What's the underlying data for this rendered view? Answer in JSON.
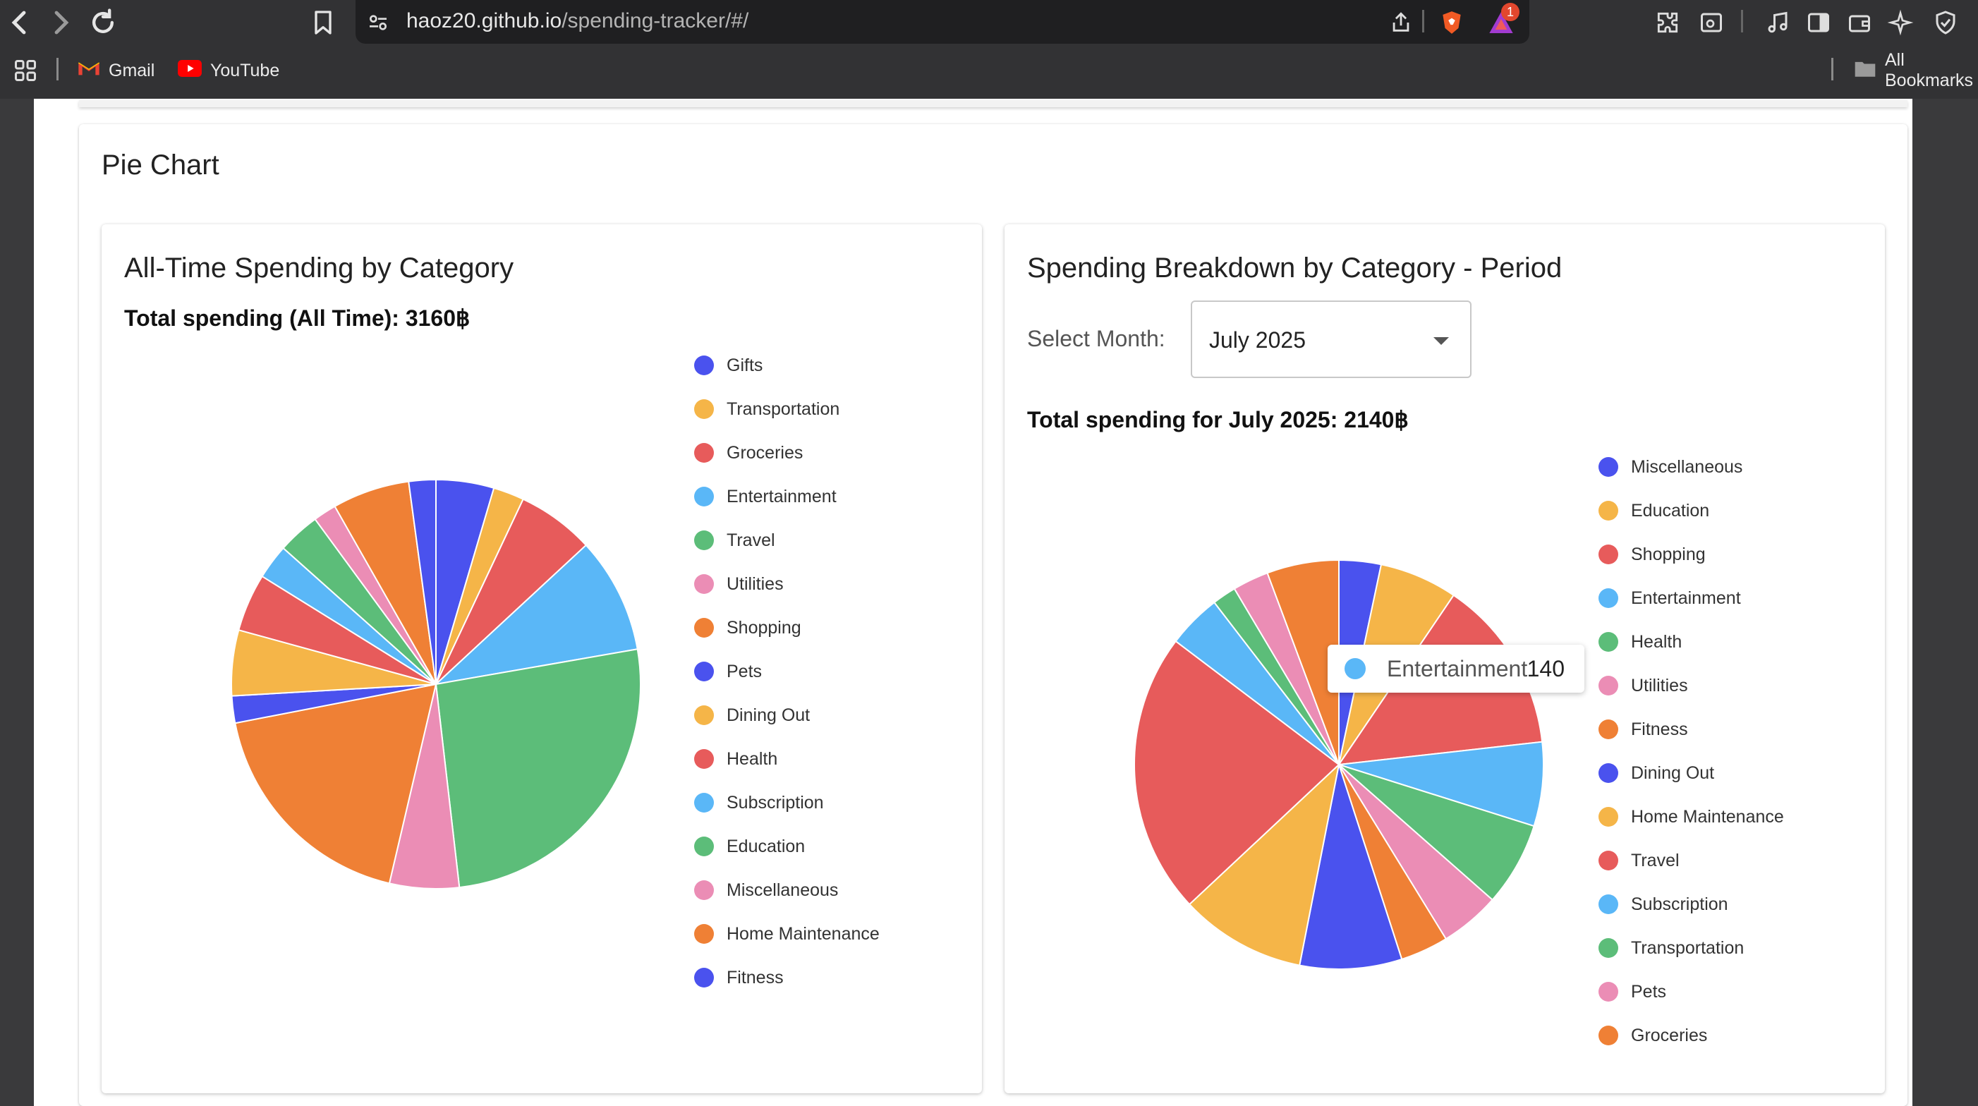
{
  "browser": {
    "url_host": "haoz20.github.io",
    "url_path": "/spending-tracker/#/",
    "notification_count": "1",
    "bookmarks": [
      {
        "label": "Gmail",
        "icon": "gmail-icon"
      },
      {
        "label": "YouTube",
        "icon": "youtube-icon"
      }
    ],
    "all_bookmarks_label": "All Bookmarks"
  },
  "page": {
    "section_title": "Pie Chart",
    "left_card": {
      "title": "All-Time Spending by Category",
      "total": "Total spending (All Time): 3160฿"
    },
    "right_card": {
      "title": "Spending Breakdown by Category - Period",
      "select_label": "Select Month:",
      "selected_month": "July 2025",
      "total": "Total spending for July 2025: 2140฿"
    },
    "tooltip": {
      "label": "Entertainment",
      "value": "140",
      "color": "#5ab7f7"
    }
  },
  "colors": {
    "blue": "#4a52ee",
    "orange": "#f5b548",
    "red": "#e75b5b",
    "sky": "#5ab7f7",
    "green": "#5cbd79",
    "pink": "#eb8db5",
    "dark_orange": "#ef8035"
  },
  "chart_data": [
    {
      "type": "pie",
      "title": "All-Time Spending by Category",
      "total": 3160,
      "categories": [
        "Gifts",
        "Transportation",
        "Groceries",
        "Entertainment",
        "Travel",
        "Utilities",
        "Shopping",
        "Pets",
        "Dining Out",
        "Health",
        "Subscription",
        "Education",
        "Miscellaneous",
        "Home Maintenance",
        "Fitness"
      ],
      "colors": [
        "#4a52ee",
        "#f5b548",
        "#e75b5b",
        "#5ab7f7",
        "#5cbd79",
        "#eb8db5",
        "#ef8035",
        "#4a52ee",
        "#f5b548",
        "#e75b5b",
        "#5ab7f7",
        "#5cbd79",
        "#eb8db5",
        "#ef8035",
        "#4a52ee"
      ],
      "values": [
        150,
        80,
        200,
        300,
        850,
        180,
        600,
        70,
        170,
        150,
        90,
        110,
        60,
        200,
        70
      ],
      "legend": "right"
    },
    {
      "type": "pie",
      "title": "Spending Breakdown by Category - Period",
      "total": 2140,
      "categories": [
        "Miscellaneous",
        "Education",
        "Shopping",
        "Entertainment",
        "Health",
        "Utilities",
        "Fitness",
        "Dining Out",
        "Home Maintenance",
        "Travel",
        "Subscription",
        "Transportation",
        "Pets",
        "Groceries"
      ],
      "colors": [
        "#4a52ee",
        "#f5b548",
        "#e75b5b",
        "#5ab7f7",
        "#5cbd79",
        "#eb8db5",
        "#ef8035",
        "#4a52ee",
        "#f5b548",
        "#e75b5b",
        "#5ab7f7",
        "#5cbd79",
        "#eb8db5",
        "#ef8035"
      ],
      "values": [
        70,
        130,
        290,
        140,
        140,
        100,
        80,
        170,
        210,
        470,
        90,
        40,
        60,
        120
      ],
      "legend": "right"
    }
  ]
}
